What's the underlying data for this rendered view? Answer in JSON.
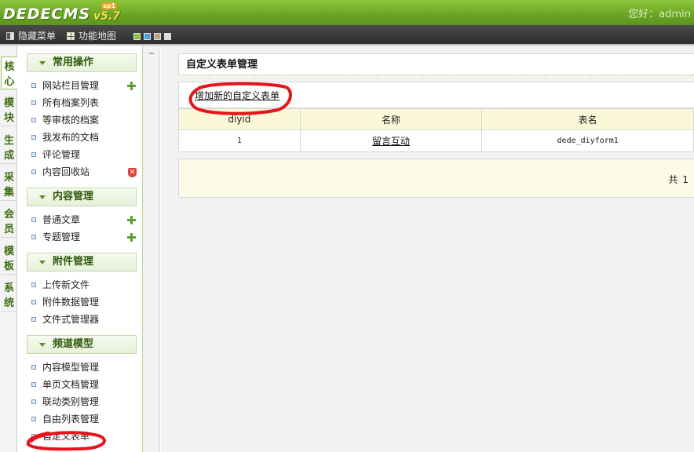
{
  "header": {
    "brand": "DEDECMS",
    "version": "v5.7",
    "edition": "sp1",
    "greeting": "您好：",
    "username": "admin"
  },
  "toolbar": {
    "hide_menu": "隐藏菜单",
    "site_map": "功能地图",
    "swatch_colors": [
      "#8cc63a",
      "#4aa3df",
      "#b9a57a",
      "#dedede"
    ]
  },
  "vtabs": [
    "核心",
    "模块",
    "生成",
    "采集",
    "会员",
    "模板",
    "系统"
  ],
  "menu": {
    "groups": [
      {
        "title": "常用操作",
        "items": [
          "网站栏目管理",
          "所有档案列表",
          "等审核的档案",
          "我发布的文档",
          "评论管理",
          "内容回收站"
        ]
      },
      {
        "title": "内容管理",
        "items": [
          "普通文章",
          "专题管理"
        ]
      },
      {
        "title": "附件管理",
        "items": [
          "上传新文件",
          "附件数据管理",
          "文件式管理器"
        ]
      },
      {
        "title": "频道模型",
        "items": [
          "内容模型管理",
          "单页文档管理",
          "联动类别管理",
          "自由列表管理",
          "自定义表单"
        ]
      }
    ]
  },
  "main": {
    "title": "自定义表单管理",
    "add_link": "增加新的自定义表单",
    "columns": [
      "diyid",
      "名称",
      "表名"
    ],
    "rows": [
      {
        "diyid": "1",
        "name": "留言互动",
        "table": "dede_diyform1"
      }
    ],
    "pager": "共 1"
  },
  "colors": {
    "header_green": "#6aa425",
    "annotation_red": "#e8141b"
  }
}
